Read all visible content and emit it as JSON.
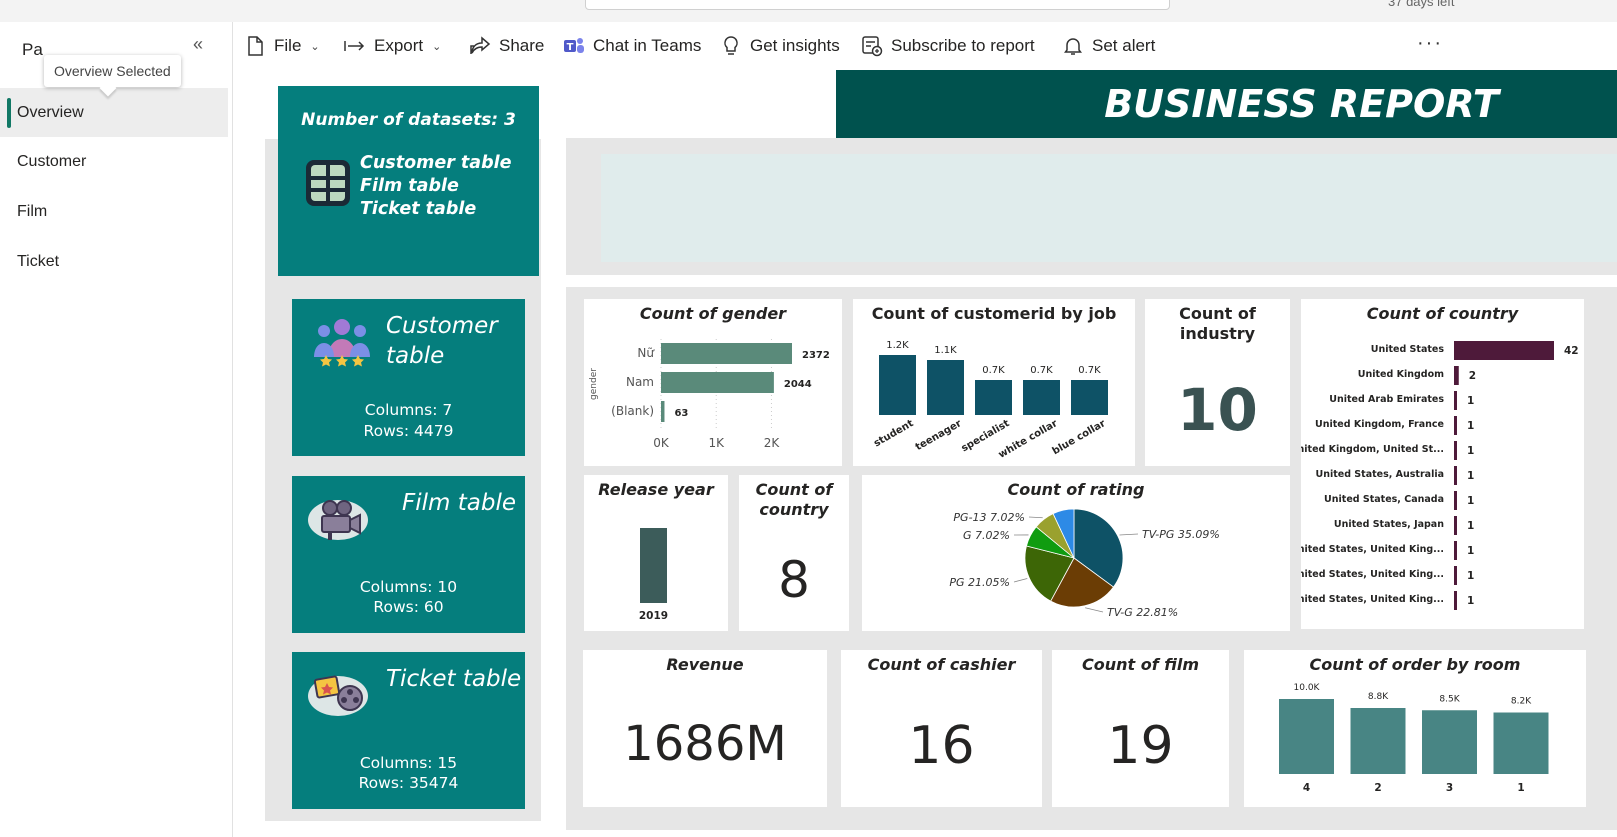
{
  "app": {
    "trial_text": "37 days left",
    "nav_title": "Pa",
    "tooltip": "Overview Selected"
  },
  "nav": {
    "items": [
      {
        "label": "Overview",
        "active": true
      },
      {
        "label": "Customer",
        "active": false
      },
      {
        "label": "Film",
        "active": false
      },
      {
        "label": "Ticket",
        "active": false
      }
    ]
  },
  "toolbar": {
    "file": "File",
    "export": "Export",
    "share": "Share",
    "teams": "Chat in Teams",
    "insights": "Get insights",
    "subscribe": "Subscribe to report",
    "alert": "Set alert",
    "more": "···"
  },
  "report": {
    "title": "BUSINESS REPORT",
    "datasets": {
      "heading": "Number of datasets: 3",
      "items": [
        "Customer table",
        "Film table",
        "Ticket table"
      ]
    },
    "tables": [
      {
        "title_line1": "Customer",
        "title_line2": "table",
        "columns": "Columns: 7",
        "rows": "Rows: 4479"
      },
      {
        "title_line1": "Film table",
        "title_line2": "",
        "columns": "Columns: 10",
        "rows": "Rows: 60"
      },
      {
        "title_line1": "Ticket table",
        "title_line2": "",
        "columns": "Columns: 15",
        "rows": "Rows: 35474"
      }
    ],
    "kpis": {
      "industry": {
        "title_line1": "Count of",
        "title_line2": "industry",
        "value": "10"
      },
      "country": {
        "title_line1": "Count of",
        "title_line2": "country",
        "value": "8"
      },
      "revenue": {
        "title": "Revenue",
        "value": "1686M"
      },
      "cashier": {
        "title": "Count of cashier",
        "value": "16"
      },
      "film": {
        "title": "Count of film",
        "value": "19"
      }
    }
  },
  "colors": {
    "teal": "#057e7d",
    "banner": "#00524e",
    "gender_bar": "#5a8a7a",
    "job_bar": "#0e5266",
    "country_bar": "#4e1a3a",
    "year_bar": "#3c5c5a",
    "room_bar": "#488584",
    "accent": "#117865"
  },
  "chart_data": [
    {
      "id": "gender",
      "type": "bar",
      "orientation": "horizontal",
      "title": "Count of gender",
      "ylabel": "gender",
      "categories": [
        "Nữ",
        "Nam",
        "(Blank)"
      ],
      "values": [
        2372,
        2044,
        63
      ],
      "value_labels": [
        "2372",
        "2044",
        "63"
      ],
      "xticks": [
        "0K",
        "1K",
        "2K"
      ],
      "xlim": [
        0,
        2372
      ]
    },
    {
      "id": "job",
      "type": "bar",
      "title": "Count of customerid by job",
      "categories": [
        "student",
        "teenager",
        "specialist",
        "white collar",
        "blue collar"
      ],
      "values": [
        1200,
        1100,
        700,
        700,
        700
      ],
      "value_labels": [
        "1.2K",
        "1.1K",
        "0.7K",
        "0.7K",
        "0.7K"
      ]
    },
    {
      "id": "country",
      "type": "bar",
      "orientation": "horizontal",
      "title": "Count of country",
      "categories": [
        "United States",
        "United Kingdom",
        "United Arab Emirates",
        "United Kingdom, France",
        "United Kingdom, United St...",
        "United States, Australia",
        "United States, Canada",
        "United States, Japan",
        "United States, United King...",
        "United States, United King...",
        "United States, United King..."
      ],
      "values": [
        42,
        2,
        1,
        1,
        1,
        1,
        1,
        1,
        1,
        1,
        1
      ]
    },
    {
      "id": "release_year",
      "type": "bar",
      "title": "Release year",
      "categories": [
        "2019"
      ],
      "values": [
        1
      ]
    },
    {
      "id": "rating",
      "type": "pie",
      "title": "Count of rating",
      "slices": [
        {
          "label": "TV-PG",
          "pct": 35.09,
          "text": "TV-PG 35.09%",
          "color": "#0e5266"
        },
        {
          "label": "TV-G",
          "pct": 22.81,
          "text": "TV-G 22.81%",
          "color": "#6b3d05"
        },
        {
          "label": "PG",
          "pct": 21.05,
          "text": "PG 21.05%",
          "color": "#3d6606"
        },
        {
          "label": "G",
          "pct": 7.02,
          "text": "G 7.02%",
          "color": "#109c10"
        },
        {
          "label": "PG-13",
          "pct": 7.02,
          "text": "PG-13 7.02%",
          "color": "#9aa12e"
        },
        {
          "label": "",
          "pct": 7.01,
          "text": "",
          "color": "#2d8ae6"
        }
      ]
    },
    {
      "id": "room",
      "type": "bar",
      "title": "Count of order by room",
      "categories": [
        "4",
        "2",
        "3",
        "1"
      ],
      "values": [
        10000,
        8800,
        8500,
        8200
      ],
      "value_labels": [
        "10.0K",
        "8.8K",
        "8.5K",
        "8.2K"
      ]
    }
  ]
}
